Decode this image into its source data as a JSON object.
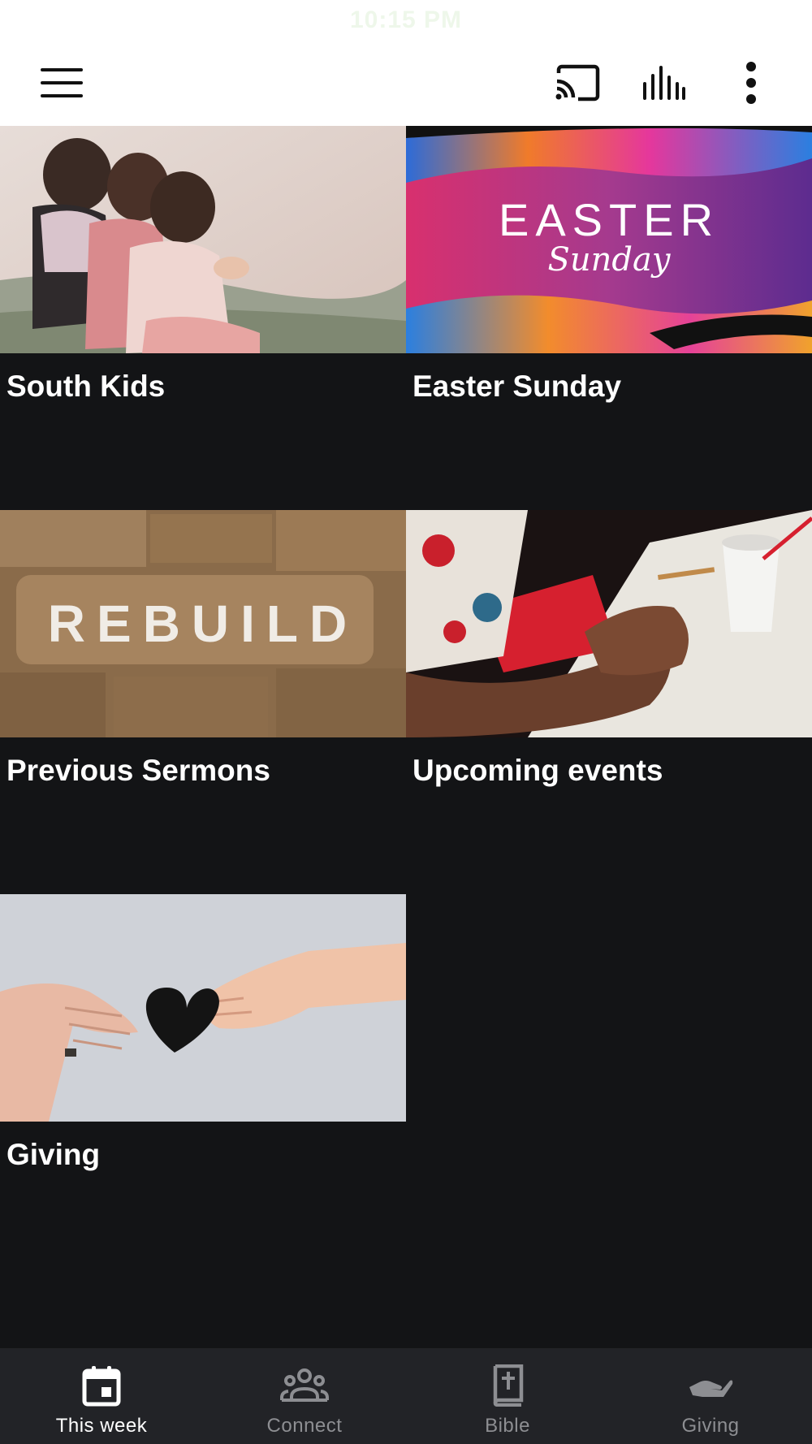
{
  "status_bar": {
    "time": "10:15 PM"
  },
  "toolbar": {
    "menu_icon": "hamburger-menu-icon",
    "cast_icon": "cast-icon",
    "audio_icon": "audio-bars-icon",
    "more_icon": "more-vertical-icon",
    "icon_color": "#111111"
  },
  "tiles": [
    {
      "title": "South Kids",
      "image": "children sitting on grass photo"
    },
    {
      "title": "Easter Sunday",
      "image": "Easter Sunday colorful banner",
      "banner_text": "EASTER",
      "banner_script": "Sunday"
    },
    {
      "title": "Previous Sermons",
      "image": "stone wall with REBUILD text",
      "banner_text": "REBUILD"
    },
    {
      "title": "Upcoming events",
      "image": "hand holding pen over table photo"
    },
    {
      "title": "Giving",
      "image": "hands passing paper heart photo"
    }
  ],
  "bottom_nav": {
    "items": [
      {
        "label": "This week",
        "icon": "calendar-icon",
        "active": true
      },
      {
        "label": "Connect",
        "icon": "people-group-icon",
        "active": false
      },
      {
        "label": "Bible",
        "icon": "bible-book-icon",
        "active": false
      },
      {
        "label": "Giving",
        "icon": "giving-hand-icon",
        "active": false
      }
    ],
    "active_color": "#ffffff",
    "inactive_color": "#8d8e92"
  },
  "colors": {
    "background": "#131416",
    "topbar": "#ffffff",
    "nav_background": "#222327"
  }
}
